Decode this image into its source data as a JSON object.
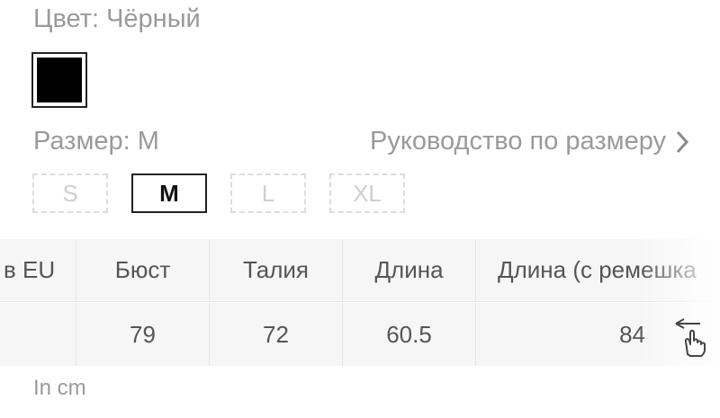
{
  "color": {
    "label": "Цвет: Чёрный",
    "swatch_color": "#000000"
  },
  "size": {
    "label": "Размер: M",
    "guide_label": "Руководство по размеру",
    "options": [
      "S",
      "M",
      "L",
      "XL"
    ],
    "selected": "M"
  },
  "table": {
    "headers": [
      "в EU",
      "Бюст",
      "Талия",
      "Длина",
      "Длина (с ремешка"
    ],
    "row": [
      "",
      "79",
      "72",
      "60.5",
      "84"
    ]
  },
  "unit_note": "In cm",
  "icons": {
    "guide": "chevron-right-icon",
    "swipe": "swipe-left-hand-icon"
  }
}
